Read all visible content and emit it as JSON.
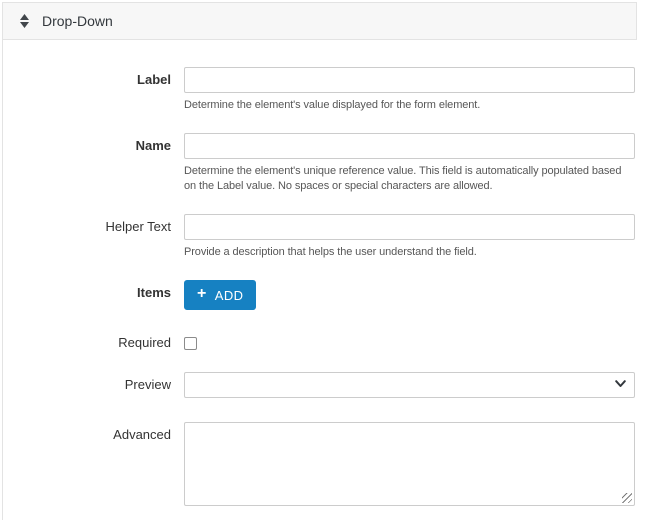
{
  "header": {
    "title": "Drop-Down",
    "icon": "move-vertical-icon"
  },
  "fields": {
    "label": {
      "label": "Label",
      "value": "",
      "helper": "Determine the element's value displayed for the form element."
    },
    "name": {
      "label": "Name",
      "value": "",
      "helper": "Determine the element's unique reference value. This field is automatically populated based on the Label value. No spaces or special characters are allowed."
    },
    "helper_text": {
      "label": "Helper Text",
      "value": "",
      "helper": "Provide a description that helps the user understand the field."
    },
    "items": {
      "label": "Items",
      "add_button_label": "ADD",
      "add_button_plus": "+"
    },
    "required": {
      "label": "Required",
      "checked": false
    },
    "preview": {
      "label": "Preview",
      "selected_value": ""
    },
    "advanced": {
      "label": "Advanced",
      "value": ""
    }
  },
  "colors": {
    "primary_button": "#1681c2",
    "header_background": "#f7f7f7",
    "panel_border": "#e3e3e3",
    "input_border": "#cccccc",
    "label_text": "#333333",
    "helper_text": "#575757"
  }
}
